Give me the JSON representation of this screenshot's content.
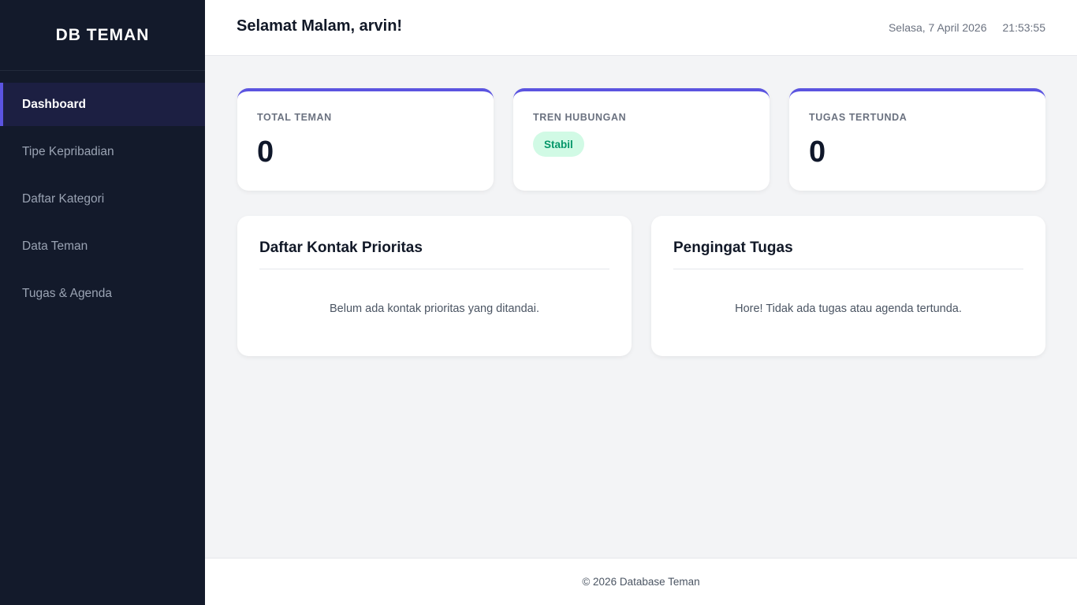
{
  "sidebar": {
    "brand": "DB TEMAN",
    "items": [
      {
        "label": "Dashboard",
        "active": true
      },
      {
        "label": "Tipe Kepribadian"
      },
      {
        "label": "Daftar Kategori"
      },
      {
        "label": "Data Teman"
      },
      {
        "label": "Tugas & Agenda"
      }
    ]
  },
  "header": {
    "greeting": "Selamat Malam, arvin!",
    "date": "Selasa, 7 April 2026",
    "time": "21:53:55"
  },
  "stats": [
    {
      "label": "TOTAL TEMAN",
      "value": "0"
    },
    {
      "label": "TREN HUBUNGAN",
      "badge": "Stabil"
    },
    {
      "label": "TUGAS TERTUNDA",
      "value": "0"
    }
  ],
  "panels": {
    "priority": {
      "title": "Daftar Kontak Prioritas",
      "empty": "Belum ada kontak prioritas yang ditandai."
    },
    "reminder": {
      "title": "Pengingat Tugas",
      "empty": "Hore! Tidak ada tugas atau agenda tertunda."
    }
  },
  "footer": {
    "text": "© 2026 Database Teman"
  },
  "colors": {
    "sidebar_bg": "#131a2b",
    "accent": "#5b54e0",
    "badge_bg": "#d1fae5",
    "badge_text": "#059669"
  }
}
